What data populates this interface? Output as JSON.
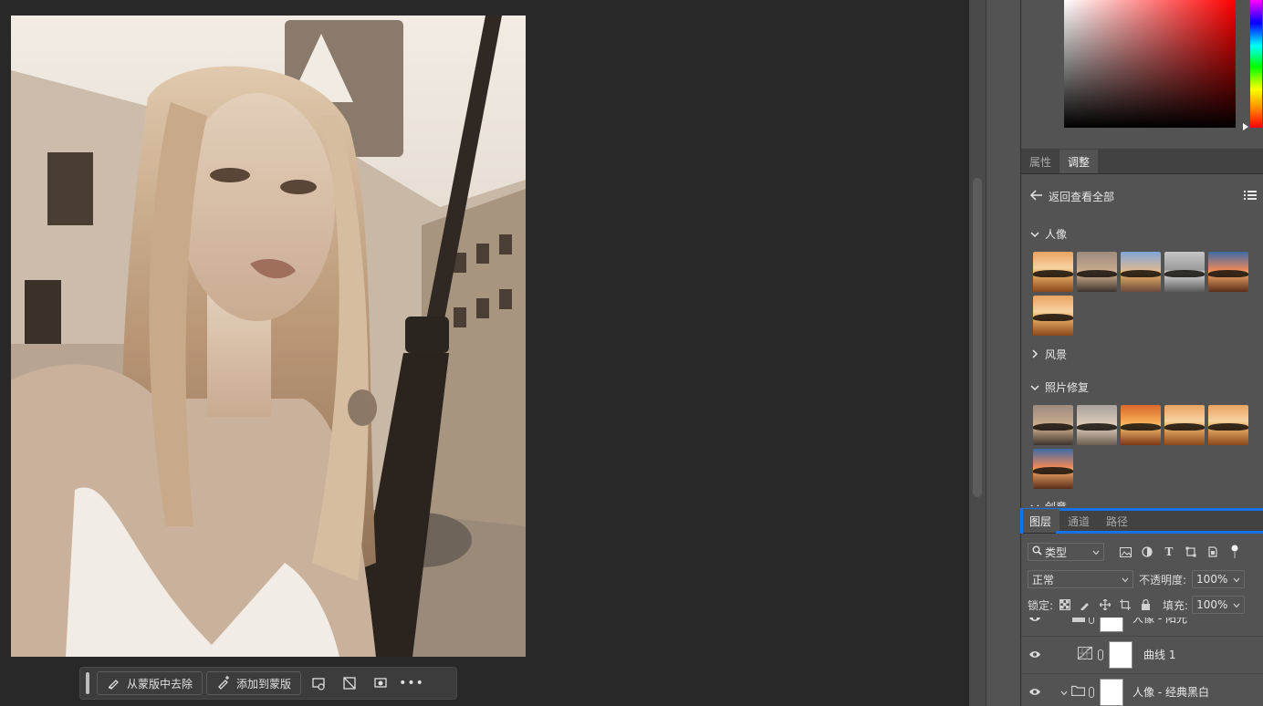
{
  "taskbar": {
    "remove_label": "从蒙版中去除",
    "add_label": "添加到蒙版"
  },
  "panel_tabs_top": {
    "tab1": "属性",
    "tab2": "调整"
  },
  "adjustments": {
    "back_label": "返回查看全部",
    "sections": [
      {
        "label": "人像",
        "expanded": true
      },
      {
        "label": "风景",
        "expanded": false
      },
      {
        "label": "照片修复",
        "expanded": true
      },
      {
        "label": "创意",
        "expanded": true
      }
    ]
  },
  "layers_tabs": {
    "tab1": "图层",
    "tab2": "通道",
    "tab3": "路径"
  },
  "layers_controls": {
    "filter_value": "类型",
    "blend_mode": "正常",
    "opacity_label": "不透明度:",
    "opacity_value": "100%",
    "lock_label": "锁定:",
    "fill_label": "填充:",
    "fill_value": "100%"
  },
  "layers": [
    {
      "name": "人像 - 阳光"
    },
    {
      "name": "曲线 1"
    },
    {
      "name": "人像 - 经典黑白"
    }
  ],
  "colors": {
    "accent_blue": "#1473e6",
    "panel": "#535353",
    "canvas_bg": "#282828"
  }
}
